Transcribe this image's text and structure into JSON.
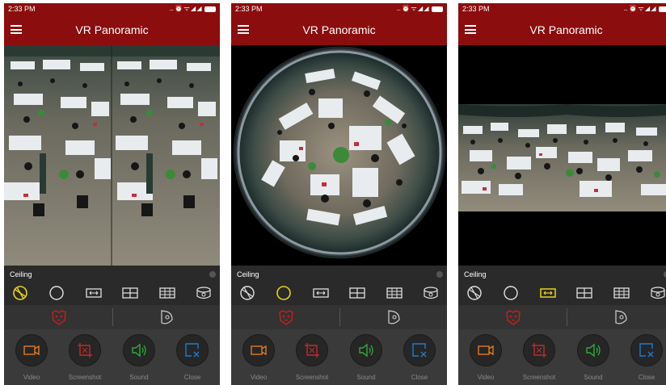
{
  "status": {
    "time": "2:33 PM",
    "icons_text": "... ⏰ ᯤ ◢ ◢"
  },
  "app": {
    "title": "VR Panoramic"
  },
  "mode_label": "Ceiling",
  "actions": {
    "video": "Video",
    "screenshot": "Screenshot",
    "sound": "Sound",
    "close": "Close"
  },
  "colors": {
    "app_bar": "#8b0d0d",
    "active_mode": "#e6d21e",
    "inactive_icon": "#e0e0e0",
    "ptz_red": "#c0201f",
    "video_orange": "#e07b1f",
    "screenshot_red": "#c42a2a",
    "sound_green": "#2eaa3c",
    "close_blue": "#1f7ad0"
  },
  "screens": [
    {
      "view": "dual-panorama",
      "active_mode": "ceiling"
    },
    {
      "view": "fisheye",
      "active_mode": "circle"
    },
    {
      "view": "single-panorama",
      "active_mode": "stretch"
    }
  ]
}
